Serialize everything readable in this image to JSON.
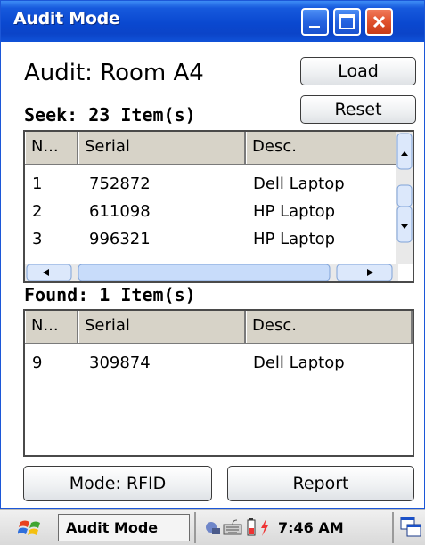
{
  "window": {
    "title": "Audit Mode",
    "controls": [
      "minimize-icon",
      "maximize-icon",
      "close-icon"
    ]
  },
  "audit": {
    "heading": "Audit: Room A4",
    "seek_label": "Seek: 23 Item(s)",
    "found_label": "Found: 1 Item(s)",
    "load_label": "Load",
    "reset_label": "Reset"
  },
  "seek_table": {
    "columns": [
      "N...",
      "Serial",
      "Desc."
    ],
    "rows": [
      [
        "1",
        "752872",
        "Dell Laptop"
      ],
      [
        "2",
        "611098",
        "HP Laptop"
      ],
      [
        "3",
        "996321",
        "HP Laptop"
      ]
    ]
  },
  "found_table": {
    "columns": [
      "N...",
      "Serial",
      "Desc."
    ],
    "rows": [
      [
        "9",
        "309874",
        "Dell Laptop"
      ]
    ]
  },
  "footer": {
    "mode_label": "Mode: RFID",
    "report_label": "Report"
  },
  "taskbar": {
    "start_icon": "windows-flag-icon",
    "active_task": "Audit Mode",
    "tray_icons": [
      "network-icon",
      "keyboard-icon",
      "battery-icon",
      "power-icon"
    ],
    "clock": "7:46 AM",
    "switch_icon": "window-switch-icon"
  },
  "colors": {
    "titlebar": "#0a48d0",
    "close_button": "#e0512c",
    "header_bg": "#d7d3c8"
  }
}
